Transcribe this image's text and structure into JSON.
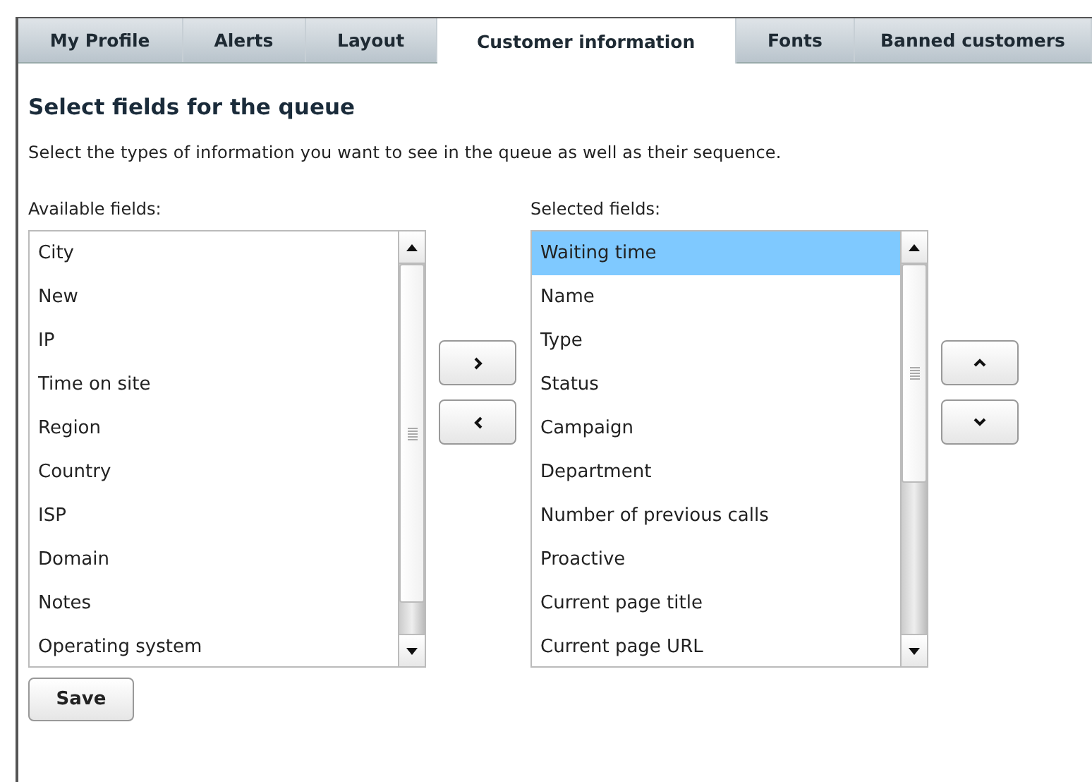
{
  "tabs": [
    {
      "label": "My Profile",
      "selected": false
    },
    {
      "label": "Alerts",
      "selected": false
    },
    {
      "label": "Layout",
      "selected": false
    },
    {
      "label": "Customer information",
      "selected": true
    },
    {
      "label": "Fonts",
      "selected": false
    },
    {
      "label": "Banned customers",
      "selected": false
    }
  ],
  "heading": "Select fields for the queue",
  "description": "Select the types of information you want to see in the queue as well as their sequence.",
  "available": {
    "label": "Available fields:",
    "items": [
      {
        "text": "City",
        "selected": false
      },
      {
        "text": "New",
        "selected": false
      },
      {
        "text": "IP",
        "selected": false
      },
      {
        "text": "Time on site",
        "selected": false
      },
      {
        "text": "Region",
        "selected": false
      },
      {
        "text": "Country",
        "selected": false
      },
      {
        "text": "ISP",
        "selected": false
      },
      {
        "text": "Domain",
        "selected": false
      },
      {
        "text": "Notes",
        "selected": false
      },
      {
        "text": "Operating system",
        "selected": false
      }
    ]
  },
  "selected_fields": {
    "label": "Selected fields:",
    "items": [
      {
        "text": "Waiting time",
        "selected": true
      },
      {
        "text": "Name",
        "selected": false
      },
      {
        "text": "Type",
        "selected": false
      },
      {
        "text": "Status",
        "selected": false
      },
      {
        "text": "Campaign",
        "selected": false
      },
      {
        "text": "Department",
        "selected": false
      },
      {
        "text": "Number of previous calls",
        "selected": false
      },
      {
        "text": "Proactive",
        "selected": false
      },
      {
        "text": "Current page title",
        "selected": false
      },
      {
        "text": "Current page URL",
        "selected": false
      }
    ]
  },
  "save_button": "Save"
}
